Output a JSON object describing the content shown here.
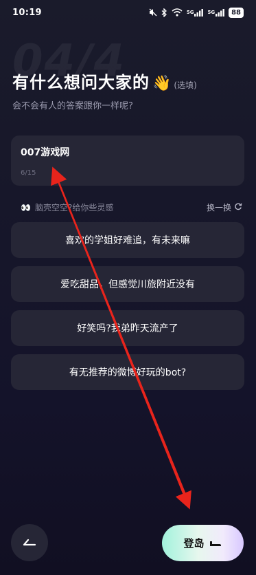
{
  "status_bar": {
    "time": "10:19",
    "icons": [
      "mute-icon",
      "bluetooth-icon",
      "wifi-icon",
      "5g-signal-icon",
      "5g-signal-icon-2"
    ],
    "signal_label_1": "5G",
    "signal_label_2": "5G",
    "battery": "88"
  },
  "watermark": "04/4",
  "header": {
    "title": "有什么想问大家的",
    "emoji": "👋",
    "optional_label": "(选填)",
    "subtitle": "会不会有人的答案跟你一样呢?"
  },
  "question_input": {
    "value": "007游戏网",
    "counter": "6/15"
  },
  "inspiration": {
    "emoji": "👀",
    "hint": "脑壳空空?给你些灵感",
    "shuffle_label": "换一换"
  },
  "suggestions": [
    "喜欢的学姐好难追，有未来嘛",
    "爱吃甜品，但感觉川旅附近没有",
    "好笑吗?我弟昨天流产了",
    "有无推荐的微博好玩的bot?"
  ],
  "footer": {
    "login_label": "登岛"
  },
  "colors": {
    "background": "#17172a",
    "card": "#262636",
    "annotation_arrow": "#e8241c",
    "button_gradient_start": "#a2f2dc",
    "button_gradient_end": "#d8c8ff"
  }
}
